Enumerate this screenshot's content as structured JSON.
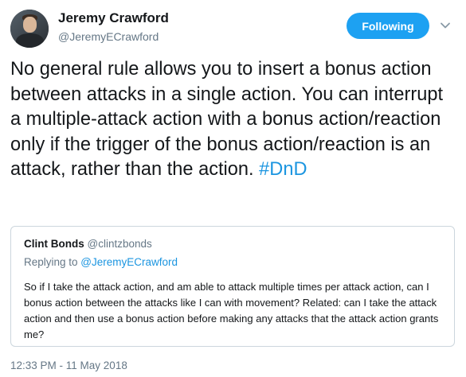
{
  "author": {
    "name": "Jeremy Crawford",
    "handle": "@JeremyECrawford"
  },
  "follow_button": {
    "label": "Following"
  },
  "tweet": {
    "text": "No general rule allows you to insert a bonus action between attacks in a single action. You can interrupt a multiple-attack action with a bonus action/reaction only if the trigger of the bonus action/reaction is an attack, rather than the action. ",
    "hashtag": "#DnD",
    "timestamp": "12:33 PM - 11 May 2018"
  },
  "quoted_tweet": {
    "name": "Clint Bonds",
    "handle": "@clintzbonds",
    "replying_prefix": "Replying to ",
    "replying_to": "@JeremyECrawford",
    "text": "So if I take the attack action, and am able to attack multiple times per attack action, can I bonus action between the attacks like I can with movement? Related: can I take the attack action and then use a bonus action before making any attacks that the attack action grants me?"
  },
  "colors": {
    "accent": "#1da1f2",
    "link": "#1b95e0",
    "secondary_text": "#657786",
    "border": "#ccd6dd"
  },
  "icons": {
    "avatar": "profile-photo",
    "menu": "chevron-down-icon"
  }
}
